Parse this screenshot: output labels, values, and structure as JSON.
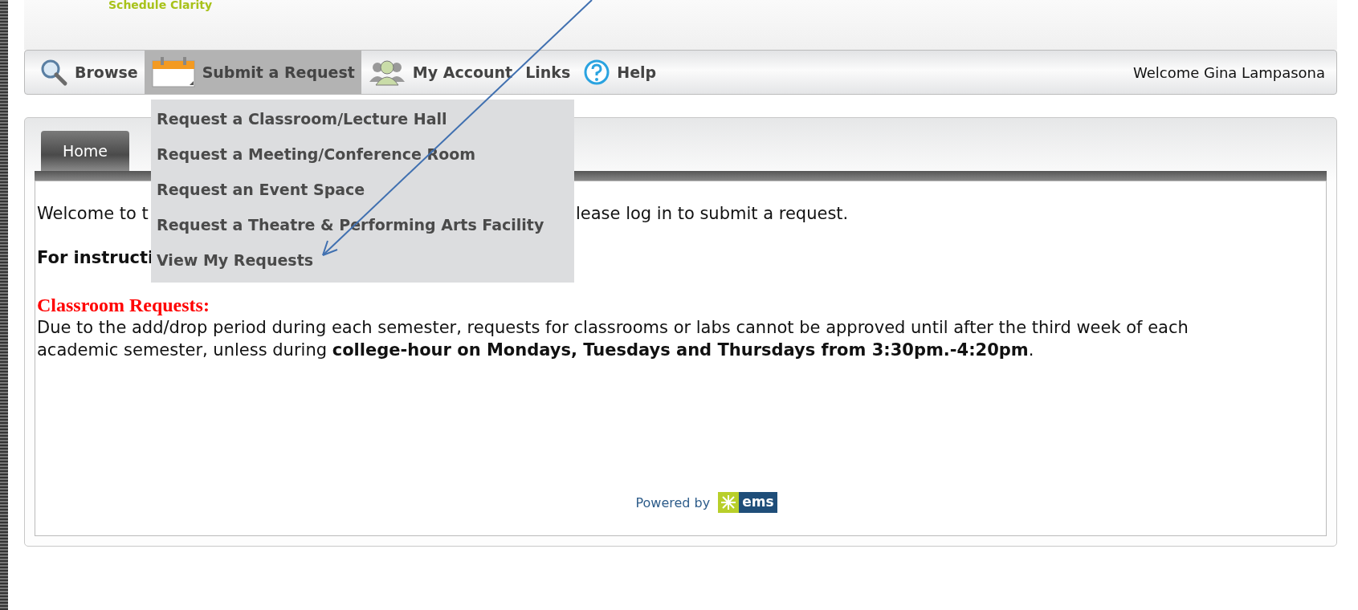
{
  "logo": {
    "tagline": "Schedule Clarity"
  },
  "nav": {
    "items": [
      {
        "label": "Browse",
        "kind": "search",
        "selected": false
      },
      {
        "label": "Submit a Request",
        "kind": "calendar",
        "selected": true
      },
      {
        "label": "My Account",
        "kind": "people",
        "selected": false
      },
      {
        "label": "Links",
        "kind": "none",
        "selected": false
      },
      {
        "label": "Help",
        "kind": "help",
        "selected": false
      }
    ],
    "welcome": "Welcome Gina Lampasona"
  },
  "dropdown": {
    "items": [
      "Request a Classroom/Lecture Hall",
      "Request a Meeting/Conference Room",
      "Request an Event Space",
      "Request a Theatre & Performing Arts Facility",
      "View My Requests"
    ]
  },
  "tabs": [
    {
      "label": "Home",
      "selected": true
    }
  ],
  "content": {
    "intro_start": "Welcome to t",
    "intro_end": "lease log in to submit a request.",
    "instructions_start": "For instructi",
    "heading": "Classroom Requests:",
    "notice": "Due to the add/drop period during each semester, requests for classrooms or labs cannot be approved until after the third week of each academic semester, unless during **college-hour on Mondays, Tuesdays and Thursdays from 3:30pm.-4:20pm**."
  },
  "footer": {
    "powered_by": "Powered by",
    "brand": "ems"
  }
}
